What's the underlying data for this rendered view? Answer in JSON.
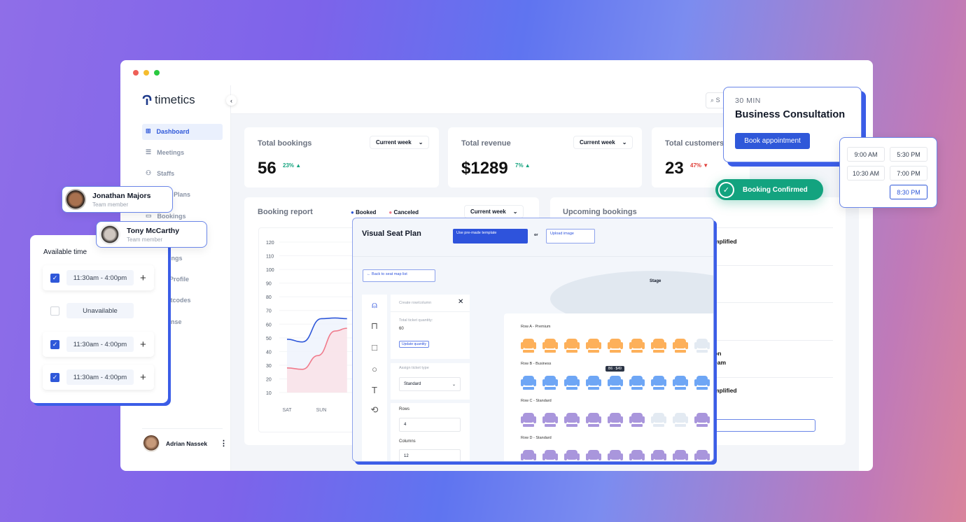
{
  "window": {
    "dots": [
      "#ee5f57",
      "#f5bd2f",
      "#2ac940"
    ]
  },
  "brand": {
    "name": "timetics",
    "accent": "#2f58d9"
  },
  "sidebar": {
    "items": [
      {
        "label": "Dashboard",
        "icon": "grid-icon",
        "active": true
      },
      {
        "label": "Meetings",
        "icon": "meetings-icon"
      },
      {
        "label": "Staffs",
        "icon": "users-icon"
      },
      {
        "label": "Plans",
        "icon": "plans-icon"
      },
      {
        "label": "Bookings",
        "icon": "calendar-icon"
      },
      {
        "label": "ings"
      },
      {
        "label": "Profile"
      },
      {
        "label": "rtcodes"
      },
      {
        "label": "nse"
      }
    ],
    "user": {
      "name": "Adrian Nassek"
    }
  },
  "search": {
    "placeholder": "S"
  },
  "stats": [
    {
      "title": "Total bookings",
      "value": "56",
      "change": "23%",
      "trend": "up",
      "period": "Current week"
    },
    {
      "title": "Total revenue",
      "value": "$1289",
      "change": "7%",
      "trend": "up",
      "period": "Current week"
    },
    {
      "title": "Total customers",
      "value": "23",
      "change": "47%",
      "trend": "down"
    }
  ],
  "report": {
    "title": "Booking report",
    "period": "Current week",
    "legend": [
      {
        "label": "Booked",
        "color": "#2f58d9"
      },
      {
        "label": "Canceled",
        "color": "#f07b8c"
      }
    ]
  },
  "chart_data": {
    "type": "area",
    "y_ticks": [
      120,
      110,
      100,
      90,
      80,
      70,
      60,
      50,
      40,
      30,
      20,
      10
    ],
    "categories": [
      "SAT",
      "SUN"
    ],
    "ylim": [
      10,
      120
    ],
    "series": [
      {
        "name": "Booked",
        "color": "#2f58d9",
        "points": [
          [
            0,
            49
          ],
          [
            0.45,
            47
          ],
          [
            1,
            64
          ],
          [
            1.4,
            64.5
          ],
          [
            1.75,
            64
          ]
        ]
      },
      {
        "name": "Canceled",
        "color": "#f07b8c",
        "points": [
          [
            0,
            28
          ],
          [
            0.45,
            27
          ],
          [
            0.9,
            37
          ],
          [
            1.4,
            55
          ],
          [
            1.75,
            57
          ]
        ]
      }
    ]
  },
  "upcoming": {
    "title": "Upcoming bookings",
    "rows": [
      [
        "mplified"
      ],
      [],
      [],
      [
        "on",
        "eam"
      ],
      [
        "mplified"
      ]
    ]
  },
  "seatplan": {
    "title": "Visual Seat Plan",
    "template_btn": "Use pre-made template",
    "or": "or",
    "upload_btn": "Upload image",
    "back": "← Back to seat map list",
    "stage": "Stage",
    "panel": {
      "title": "Create row/column",
      "total_label": "Total ticket quantity:",
      "total": "60",
      "update": "Update quantity",
      "assign_label": "Assign ticket type",
      "assign_value": "Standard",
      "rows_label": "Rows",
      "rows": "4",
      "cols_label": "Columns",
      "cols": "12"
    },
    "tooltip": "B6 · $49",
    "colors": {
      "premium": "#fdb05a",
      "business": "#6ea6f5",
      "standard": "#a996dc",
      "empty": "#e3eaf2"
    },
    "rows": [
      {
        "label": "Row A - Premium",
        "type": "premium",
        "seats": [
          1,
          1,
          1,
          1,
          1,
          1,
          1,
          1,
          0
        ]
      },
      {
        "label": "Row B - Business",
        "type": "business",
        "seats": [
          1,
          1,
          1,
          1,
          1,
          1,
          1,
          1,
          1
        ]
      },
      {
        "label": "Row C - Standard",
        "type": "standard",
        "seats": [
          1,
          1,
          1,
          1,
          1,
          1,
          0,
          0,
          1
        ]
      },
      {
        "label": "Row D - Standard",
        "type": "standard",
        "seats": [
          1,
          1,
          1,
          1,
          1,
          1,
          1,
          1,
          1
        ]
      }
    ]
  },
  "consult": {
    "duration": "30 MIN",
    "title": "Business Consultation",
    "button": "Book appointment"
  },
  "slots": [
    "9:00 AM",
    "5:30 PM",
    "10:30 AM",
    "7:00 PM",
    "8:30 PM"
  ],
  "confirmed": {
    "label": "Booking Confirmed",
    "color": "#13a37f"
  },
  "members": [
    {
      "name": "Jonathan Majors",
      "role": "Team member"
    },
    {
      "name": "Tony McCarthy",
      "role": "Team member"
    }
  ],
  "availability": {
    "title": "Available time",
    "rows": [
      {
        "checked": true,
        "time": "11:30am - 4:00pm"
      },
      {
        "checked": false,
        "time": "Unavailable"
      },
      {
        "checked": true,
        "time": "11:30am - 4:00pm"
      },
      {
        "checked": true,
        "time": "11:30am - 4:00pm"
      }
    ]
  }
}
